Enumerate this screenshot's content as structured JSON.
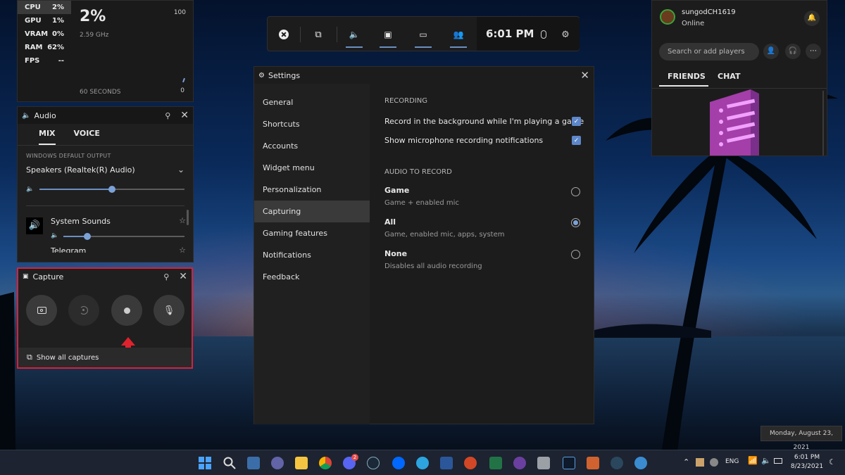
{
  "performance": {
    "stats": [
      {
        "label": "CPU",
        "value": "2%"
      },
      {
        "label": "GPU",
        "value": "1%"
      },
      {
        "label": "VRAM",
        "value": "0%"
      },
      {
        "label": "RAM",
        "value": "62%"
      },
      {
        "label": "FPS",
        "value": "--"
      }
    ],
    "big_value": "2%",
    "ghz": "2.59 GHz",
    "max": "100",
    "seconds": "60 SECONDS",
    "zero": "0"
  },
  "audio": {
    "title": "Audio",
    "tabs": [
      "MIX",
      "VOICE"
    ],
    "output_label": "WINDOWS DEFAULT OUTPUT",
    "device": "Speakers (Realtek(R) Audio)",
    "master_volume": 0.5,
    "apps": [
      {
        "name": "System Sounds",
        "volume": 0.2
      },
      {
        "name": "Telegram"
      }
    ]
  },
  "capture": {
    "title": "Capture",
    "show_all": "Show all captures"
  },
  "gamebar": {
    "time": "6:01 PM"
  },
  "settings": {
    "title": "Settings",
    "nav": [
      "General",
      "Shortcuts",
      "Accounts",
      "Widget menu",
      "Personalization",
      "Capturing",
      "Gaming features",
      "Notifications",
      "Feedback"
    ],
    "selected": "Capturing",
    "recording_heading": "RECORDING",
    "record_bg": "Record in the background while I'm playing a game",
    "show_mic": "Show microphone recording notifications",
    "audio_heading": "AUDIO TO RECORD",
    "options": [
      {
        "title": "Game",
        "desc": "Game + enabled mic",
        "selected": false
      },
      {
        "title": "All",
        "desc": "Game, enabled mic, apps, system",
        "selected": true
      },
      {
        "title": "None",
        "desc": "Disables all audio recording",
        "selected": false
      }
    ]
  },
  "social": {
    "username": "sungodCH1619",
    "status": "Online",
    "search_placeholder": "Search or add players",
    "tabs": [
      "FRIENDS",
      "CHAT"
    ]
  },
  "tooltip": {
    "date_long": "Monday, August 23, 2021"
  },
  "taskbar": {
    "lang": "ENG",
    "time": "6:01 PM",
    "date": "8/23/2021",
    "discord_badge": "2"
  },
  "colors": {
    "accent": "#7aa2d8",
    "highlight": "#d6213c"
  }
}
